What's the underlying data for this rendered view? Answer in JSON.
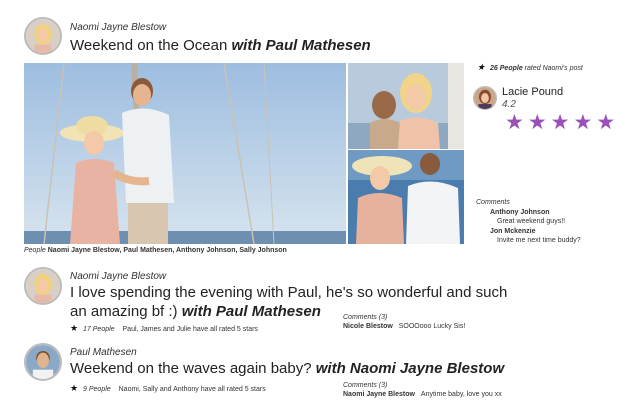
{
  "post1": {
    "author": "Naomi Jayne Blestow",
    "text": "Weekend on the Ocean",
    "tag": "with Paul Mathesen",
    "people_label": "People",
    "people": "Naomi Jayne Blestow, Paul Mathesen, Anthony Johnson, Sally Johnson",
    "rated_count": "26 People",
    "rated_text": "rated Naomi's post",
    "rater": {
      "name": "Lacie Pound",
      "score": "4.2"
    },
    "rater_stars": 5,
    "comments_label": "Comments",
    "comments": [
      {
        "author": "Anthony Johnson",
        "text": "Great weekend guys!!"
      },
      {
        "author": "Jon Mckenzie",
        "text": "Invite me next time buddy?"
      }
    ]
  },
  "post2": {
    "author": "Naomi Jayne Blestow",
    "text_line1": "I love spending the evening with Paul, he's so wonderful and such",
    "text_line2": "an amazing bf :)",
    "tag": "with Paul Mathesen",
    "rated_count": "17 People",
    "rated_text": "Paul, James and Julie  have all rated 5 stars",
    "comments_label": "Comments (3)",
    "comment": {
      "author": "Nicole Blestow",
      "text": "SOOOooo Lucky Sis!"
    }
  },
  "post3": {
    "author": "Paul Mathesen",
    "text": "Weekend on the waves again baby?",
    "tag": "with Naomi Jayne Blestow",
    "rated_count": "9 People",
    "rated_text": "Naomi, Sally and Anthony  have all rated 5 stars",
    "comments_label": "Comments (3)",
    "comment": {
      "author": "Naomi Jayne Blestow",
      "text": "Anytime baby, love you xx"
    }
  },
  "icons": {
    "star": "★"
  },
  "colors": {
    "star_purple": "#9b4fb8",
    "sky": "#a9c7e3",
    "sea": "#3b6fa6"
  }
}
